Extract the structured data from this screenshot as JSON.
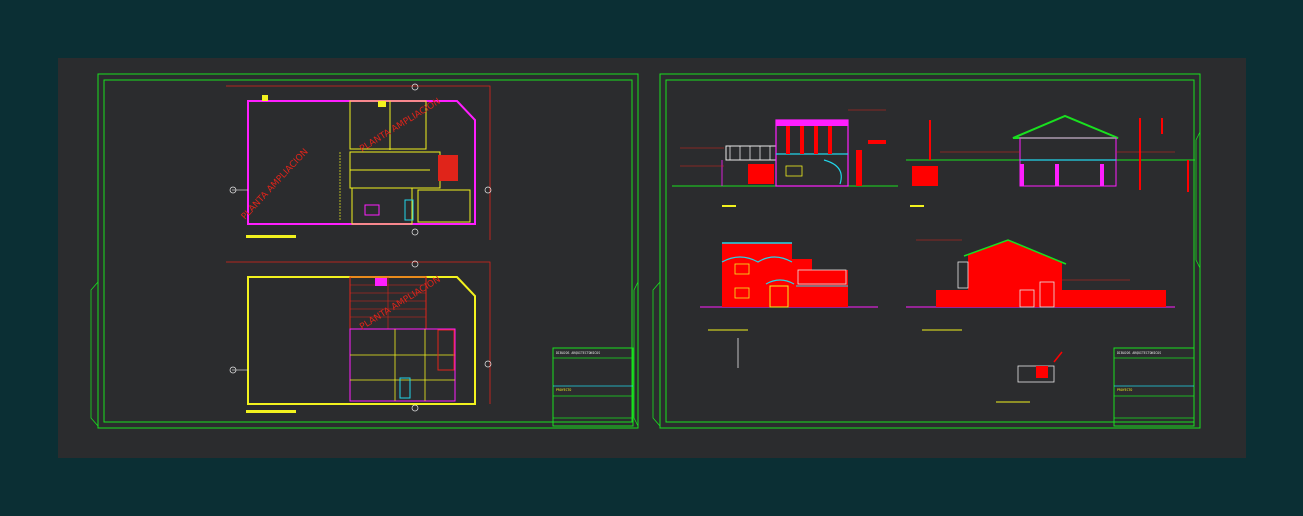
{
  "viewer": {
    "bg_color": "#0b2f34",
    "model_space_color": "#2b2c2e"
  },
  "sheets": [
    {
      "title_block": {
        "header": "DIBUJOS ARQUITECTONICOS",
        "project_label": "PROYECTO"
      },
      "watermark": "PLANTA AMPLIACION"
    },
    {
      "title_block": {
        "header": "DIBUJOS ARQUITECTONICOS",
        "project_label": "PROYECTO"
      }
    }
  ],
  "colors": {
    "frame": "#19e01f",
    "wall_magenta": "#ff1eff",
    "wall_yellow": "#f2f21e",
    "fill_red": "#ff0000",
    "line_red": "#e0241a",
    "cyan": "#22d6ea",
    "white": "#e8e8e8"
  }
}
